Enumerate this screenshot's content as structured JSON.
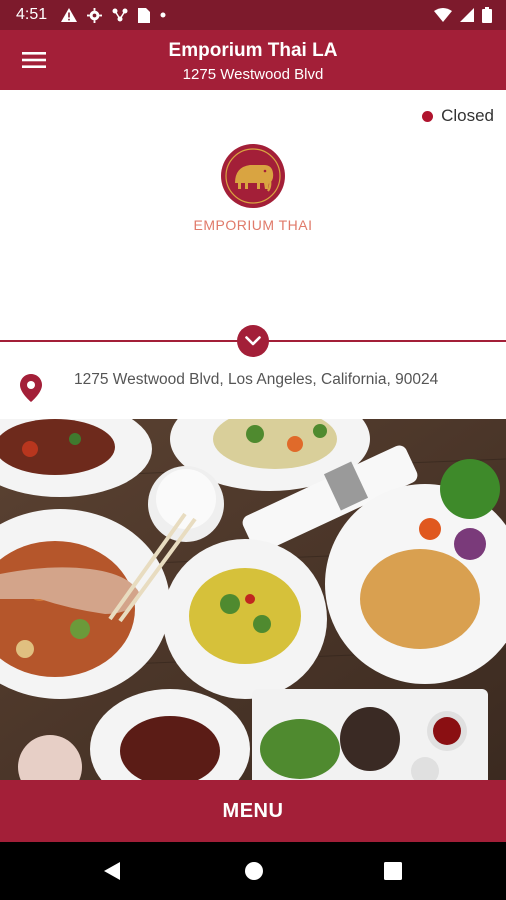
{
  "status_bar": {
    "time": "4:51",
    "icons_left": [
      "warning-icon",
      "gear-icon",
      "network-icon",
      "sim-card-icon",
      "dot-icon"
    ],
    "icons_right": [
      "wifi-icon",
      "signal-icon",
      "battery-icon"
    ]
  },
  "app_bar": {
    "title": "Emporium Thai LA",
    "subtitle": "1275 Westwood Blvd",
    "menu_icon": "hamburger-menu-icon"
  },
  "restaurant": {
    "status": "Closed",
    "status_color": "#b0142e",
    "logo_text": "EMPORIUM THAI",
    "address": "1275 Westwood Blvd, Los Angeles, California, 90024"
  },
  "actions": {
    "menu_label": "MENU"
  },
  "colors": {
    "primary": "#a31f38",
    "primary_dark": "#7d1a2c",
    "logo_text": "#e07a6a"
  }
}
